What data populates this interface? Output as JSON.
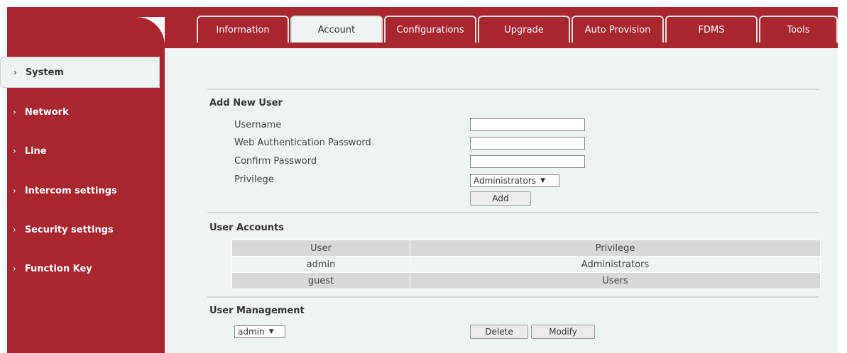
{
  "tabs": [
    {
      "label": "Information"
    },
    {
      "label": "Account"
    },
    {
      "label": "Configurations"
    },
    {
      "label": "Upgrade"
    },
    {
      "label": "Auto Provision"
    },
    {
      "label": "FDMS"
    },
    {
      "label": "Tools"
    }
  ],
  "sidebar": {
    "items": [
      {
        "label": "System"
      },
      {
        "label": "Network"
      },
      {
        "label": "Line"
      },
      {
        "label": "Intercom settings"
      },
      {
        "label": "Security settings"
      },
      {
        "label": "Function Key"
      }
    ]
  },
  "add_user": {
    "title": "Add New User",
    "username_label": "Username",
    "username_value": "",
    "password_label": "Web Authentication Password",
    "password_value": "",
    "confirm_label": "Confirm Password",
    "confirm_value": "",
    "privilege_label": "Privilege",
    "privilege_selected": "Administrators",
    "add_button": "Add"
  },
  "user_accounts": {
    "title": "User Accounts",
    "columns": [
      "User",
      "Privilege"
    ],
    "rows": [
      [
        "admin",
        "Administrators"
      ],
      [
        "guest",
        "Users"
      ]
    ]
  },
  "user_management": {
    "title": "User Management",
    "selected_user": "admin",
    "delete_button": "Delete",
    "modify_button": "Modify"
  },
  "icons": {
    "sidebar_chevron": "chevron-right-icon",
    "dropdown_arrow": "triangle-down-icon"
  },
  "colors": {
    "brand_red": "#a8262e",
    "panel_bg": "#eef3f3"
  }
}
